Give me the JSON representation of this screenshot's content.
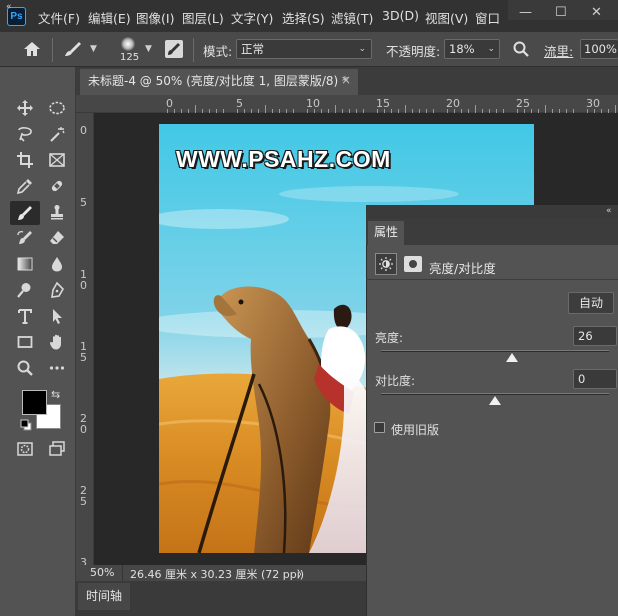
{
  "app": {
    "logo": "Ps",
    "menus": [
      "文件(F)",
      "编辑(E)",
      "图像(I)",
      "图层(L)",
      "文字(Y)",
      "选择(S)",
      "滤镜(T)",
      "3D(D)",
      "视图(V)",
      "窗口"
    ]
  },
  "options": {
    "brush_size": "125",
    "mode_label": "模式:",
    "mode_value": "正常",
    "opacity_label": "不透明度:",
    "opacity_value": "18%",
    "flow_label": "流里:",
    "flow_value": "100%"
  },
  "document": {
    "tab_title": "未标题-4 @ 50% (亮度/对比度 1, 图层蒙版/8) *",
    "watermark": "WWW.PSAHZ.COM"
  },
  "ruler": {
    "h_ticks": [
      "0",
      "5",
      "10",
      "15",
      "20",
      "25",
      "30"
    ],
    "v_ticks": [
      "0",
      "5",
      "1\n0",
      "1\n5",
      "2\n0",
      "2\n5",
      "3"
    ]
  },
  "status": {
    "zoom": "50%",
    "doc_size": "26.46 厘米 x 30.23 厘米 (72 ppi)",
    "arrow": "〉"
  },
  "bottom": {
    "timeline_tab": "时间轴"
  },
  "properties": {
    "tab": "属性",
    "adjustment_title": "亮度/对比度",
    "auto_button": "自动",
    "brightness_label": "亮度:",
    "brightness_value": "26",
    "brightness_level": 0.576,
    "contrast_label": "对比度:",
    "contrast_value": "0",
    "contrast_level": 0.5,
    "legacy_label": "使用旧版"
  },
  "colors": {
    "foreground": "#000000",
    "background": "#ffffff",
    "accent": "#31a8ff"
  }
}
